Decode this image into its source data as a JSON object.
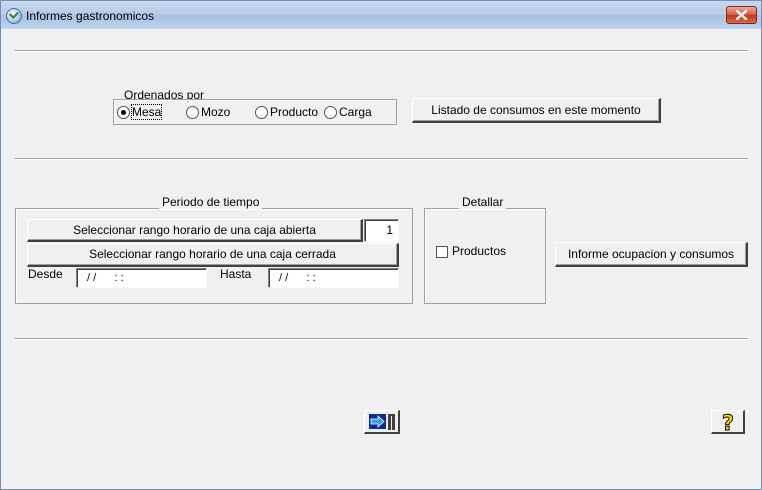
{
  "window": {
    "title": "Informes gastronomicos"
  },
  "ordenados": {
    "legend": "Ordenados por",
    "options": [
      {
        "label": "Mesa",
        "selected": true
      },
      {
        "label": "Mozo",
        "selected": false
      },
      {
        "label": "Producto",
        "selected": false
      },
      {
        "label": "Carga",
        "selected": false
      }
    ]
  },
  "listado_button": "Listado de consumos en este momento",
  "periodo": {
    "legend": "Periodo de tiempo",
    "open_button": "Seleccionar rango horario de una caja abierta",
    "open_count": "1",
    "closed_button": "Seleccionar rango horario de una caja cerrada",
    "desde_label": "Desde",
    "desde_value": "/ /      : :",
    "hasta_label": "Hasta",
    "hasta_value": "/ /      : :"
  },
  "detallar": {
    "legend": "Detallar",
    "productos_label": "Productos",
    "productos_checked": false
  },
  "informe_button": "Informe ocupacion y consumos",
  "icons": {
    "export": "export-arrow-icon",
    "help": "help-question-icon",
    "app": "app-logo-icon",
    "close": "close-icon"
  }
}
